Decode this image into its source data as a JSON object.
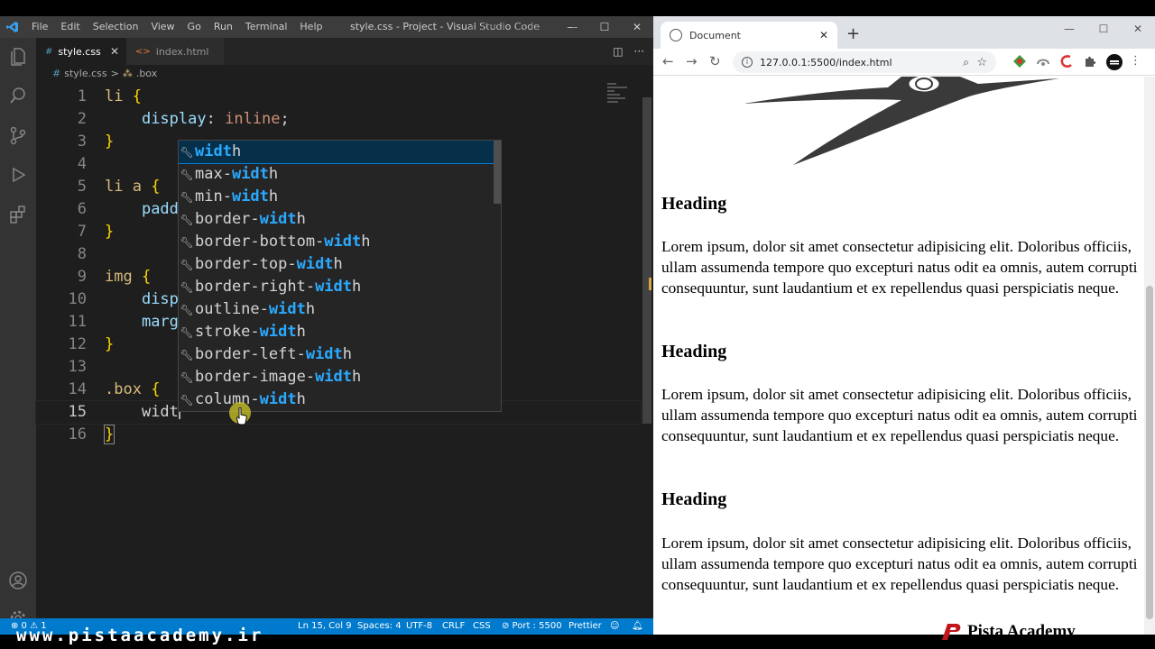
{
  "vscode": {
    "menu": [
      "File",
      "Edit",
      "Selection",
      "View",
      "Go",
      "Run",
      "Terminal",
      "Help"
    ],
    "title": "style.css - Project - Visual Studio Code",
    "tabs": [
      {
        "label": "style.css",
        "icon": "#"
      },
      {
        "label": "index.html",
        "icon": "<>"
      }
    ],
    "breadcrumb": {
      "file": "style.css",
      "sep": ">",
      "symbol": ".box"
    },
    "lines": [
      {
        "n": "1"
      },
      {
        "n": "2"
      },
      {
        "n": "3"
      },
      {
        "n": "4"
      },
      {
        "n": "5"
      },
      {
        "n": "6"
      },
      {
        "n": "7"
      },
      {
        "n": "8"
      },
      {
        "n": "9"
      },
      {
        "n": "10"
      },
      {
        "n": "11"
      },
      {
        "n": "12"
      },
      {
        "n": "13"
      },
      {
        "n": "14"
      },
      {
        "n": "15"
      },
      {
        "n": "16"
      }
    ],
    "code": {
      "l1_sel": "li",
      "l1_brace": "{",
      "l2_prop": "display",
      "l2_colon": ":",
      "l2_val": "inline",
      "l2_semi": ";",
      "l3_brace": "}",
      "l5_sel": "li a",
      "l5_brace": "{",
      "l6_prop": "padd",
      "l7_brace": "}",
      "l9_sel": "img",
      "l9_brace": "{",
      "l10_prop": "disp",
      "l11_prop": "marg",
      "l12_brace": "}",
      "l14_sel": ".box",
      "l14_brace": "{",
      "l15_prop": "widt",
      "l16_brace": "}"
    },
    "suggestions": [
      {
        "pre": "",
        "hl": "widt",
        "post": "h"
      },
      {
        "pre": "max-",
        "hl": "widt",
        "post": "h"
      },
      {
        "pre": "min-",
        "hl": "widt",
        "post": "h"
      },
      {
        "pre": "border-",
        "hl": "widt",
        "post": "h"
      },
      {
        "pre": "border-bottom-",
        "hl": "widt",
        "post": "h"
      },
      {
        "pre": "border-top-",
        "hl": "widt",
        "post": "h"
      },
      {
        "pre": "border-right-",
        "hl": "widt",
        "post": "h"
      },
      {
        "pre": "outline-",
        "hl": "widt",
        "post": "h"
      },
      {
        "pre": "stroke-",
        "hl": "widt",
        "post": "h"
      },
      {
        "pre": "border-left-",
        "hl": "widt",
        "post": "h"
      },
      {
        "pre": "border-image-",
        "hl": "widt",
        "post": "h"
      },
      {
        "pre": "column-",
        "hl": "widt",
        "post": "h"
      }
    ],
    "status": {
      "problems": "⊗ 0 ⚠ 1",
      "position": "Ln 15, Col 9",
      "spaces": "Spaces: 4",
      "encoding": "UTF-8",
      "eol": "CRLF",
      "language": "CSS",
      "port": "⊘ Port : 5500",
      "prettier": "Prettier"
    }
  },
  "chrome": {
    "tab_title": "Document",
    "url": "127.0.0.1:5500/index.html",
    "content": [
      {
        "heading": "Heading",
        "text": "Lorem ipsum, dolor sit amet consectetur adipisicing elit. Doloribus officiis, ullam assumenda tempore quo excepturi natus odit ea omnis, autem corrupti consequuntur, sunt laudantium et ex repellendus quasi perspiciatis neque."
      },
      {
        "heading": "Heading",
        "text": "Lorem ipsum, dolor sit amet consectetur adipisicing elit. Doloribus officiis, ullam assumenda tempore quo excepturi natus odit ea omnis, autem corrupti consequuntur, sunt laudantium et ex repellendus quasi perspiciatis neque."
      },
      {
        "heading": "Heading",
        "text": "Lorem ipsum, dolor sit amet consectetur adipisicing elit. Doloribus officiis, ullam assumenda tempore quo excepturi natus odit ea omnis, autem corrupti consequuntur, sunt laudantium et ex repellendus quasi perspiciatis neque."
      }
    ]
  },
  "watermark": {
    "site": "www.pistaacademy.ir",
    "brand": "Pista Academy",
    "title_overlay": "Pista Academy"
  },
  "colors": {
    "statusbar": "#007acc",
    "suggest_highlight": "#2aaaff",
    "selector": "#d7ba7d",
    "property": "#9cdcfe",
    "value": "#ce9178",
    "brace": "#ffd700"
  },
  "icons": [
    "vscode-logo-icon",
    "explorer-icon",
    "search-icon",
    "source-control-icon",
    "run-debug-icon",
    "extensions-icon",
    "account-icon",
    "settings-gear-icon",
    "wrench-icon",
    "globe-icon",
    "back-icon",
    "forward-icon",
    "reload-icon",
    "info-icon",
    "zoom-icon",
    "star-icon",
    "puzzle-icon"
  ]
}
